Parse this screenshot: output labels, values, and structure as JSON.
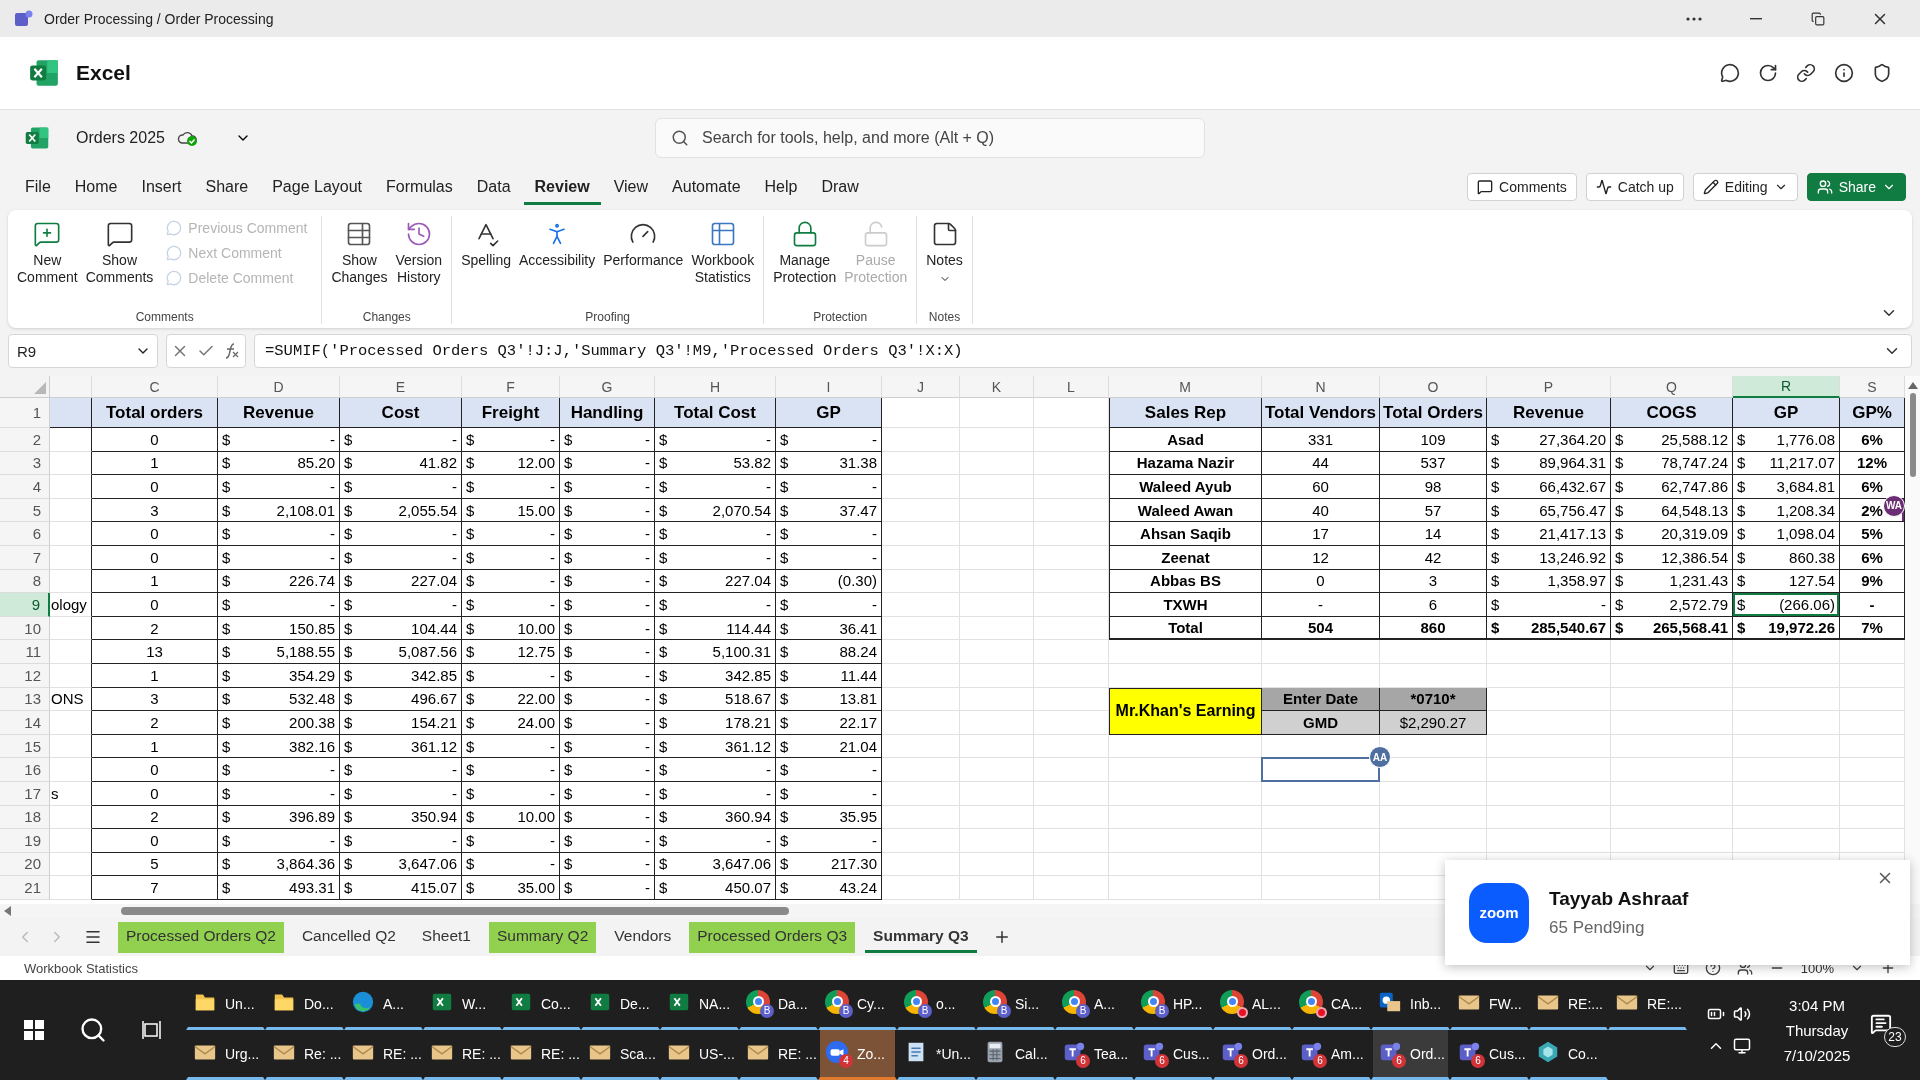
{
  "window": {
    "title": "Order Processing / Order Processing"
  },
  "app": {
    "name": "Excel"
  },
  "document": {
    "name": "Orders 2025"
  },
  "search": {
    "placeholder": "Search for tools, help, and more (Alt + Q)"
  },
  "menu_tabs": [
    {
      "label": "File",
      "selected": false
    },
    {
      "label": "Home",
      "selected": false
    },
    {
      "label": "Insert",
      "selected": false
    },
    {
      "label": "Share",
      "selected": false
    },
    {
      "label": "Page Layout",
      "selected": false
    },
    {
      "label": "Formulas",
      "selected": false
    },
    {
      "label": "Data",
      "selected": false
    },
    {
      "label": "Review",
      "selected": true
    },
    {
      "label": "View",
      "selected": false
    },
    {
      "label": "Automate",
      "selected": false
    },
    {
      "label": "Help",
      "selected": false
    },
    {
      "label": "Draw",
      "selected": false
    }
  ],
  "actions": [
    {
      "label": "Comments",
      "kind": "outline"
    },
    {
      "label": "Catch up",
      "kind": "outline"
    },
    {
      "label": "Editing",
      "kind": "dropdown"
    },
    {
      "label": "Share",
      "kind": "primary"
    }
  ],
  "ribbon": [
    {
      "name": "Comments",
      "items": [
        {
          "label": "New Comment",
          "kind": "large",
          "disabled": false
        },
        {
          "label": "Show Comments",
          "kind": "large",
          "disabled": false
        },
        {
          "label": "Previous Comment",
          "kind": "small",
          "disabled": true
        },
        {
          "label": "Next Comment",
          "kind": "small",
          "disabled": true
        },
        {
          "label": "Delete Comment",
          "kind": "small",
          "disabled": true
        }
      ]
    },
    {
      "name": "Changes",
      "items": [
        {
          "label": "Show Changes",
          "kind": "large",
          "disabled": false
        },
        {
          "label": "Version History",
          "kind": "large",
          "disabled": false
        }
      ]
    },
    {
      "name": "Proofing",
      "items": [
        {
          "label": "Spelling",
          "kind": "large",
          "disabled": false
        },
        {
          "label": "Accessibility",
          "kind": "large",
          "disabled": false
        },
        {
          "label": "Performance",
          "kind": "large",
          "disabled": false
        },
        {
          "label": "Workbook Statistics",
          "kind": "large",
          "disabled": false
        }
      ]
    },
    {
      "name": "Protection",
      "items": [
        {
          "label": "Manage Protection",
          "kind": "large",
          "disabled": false
        },
        {
          "label": "Pause Protection",
          "kind": "large",
          "disabled": true
        }
      ]
    },
    {
      "name": "Notes",
      "items": [
        {
          "label": "Notes",
          "kind": "menu",
          "disabled": false
        }
      ]
    }
  ],
  "formula_bar": {
    "name_box": "R9",
    "formula": "=SUMIF('Processed Orders Q3'!J:J,'Summary Q3'!M9,'Processed Orders Q3'!X:X)"
  },
  "sheet": {
    "column_headers": [
      {
        "label": "C",
        "selected": false
      },
      {
        "label": "D",
        "selected": false
      },
      {
        "label": "E",
        "selected": false
      },
      {
        "label": "F",
        "selected": false
      },
      {
        "label": "G",
        "selected": false
      },
      {
        "label": "H",
        "selected": false
      },
      {
        "label": "I",
        "selected": false
      },
      {
        "label": "J",
        "selected": false
      },
      {
        "label": "K",
        "selected": false
      },
      {
        "label": "L",
        "selected": false
      },
      {
        "label": "M",
        "selected": false
      },
      {
        "label": "N",
        "selected": false
      },
      {
        "label": "O",
        "selected": false
      },
      {
        "label": "P",
        "selected": false
      },
      {
        "label": "Q",
        "selected": false
      },
      {
        "label": "R",
        "selected": true
      },
      {
        "label": "S",
        "selected": false
      }
    ],
    "row_headers": [
      {
        "label": "1",
        "selected": false
      },
      {
        "label": "2",
        "selected": false
      },
      {
        "label": "3",
        "selected": false
      },
      {
        "label": "4",
        "selected": false
      },
      {
        "label": "5",
        "selected": false
      },
      {
        "label": "6",
        "selected": false
      },
      {
        "label": "7",
        "selected": false
      },
      {
        "label": "8",
        "selected": false
      },
      {
        "label": "9",
        "selected": true
      },
      {
        "label": "10",
        "selected": false
      },
      {
        "label": "11",
        "selected": false
      },
      {
        "label": "12",
        "selected": false
      },
      {
        "label": "13",
        "selected": false
      },
      {
        "label": "14",
        "selected": false
      },
      {
        "label": "15",
        "selected": false
      },
      {
        "label": "16",
        "selected": false
      },
      {
        "label": "17",
        "selected": false
      },
      {
        "label": "18",
        "selected": false
      },
      {
        "label": "19",
        "selected": false
      },
      {
        "label": "20",
        "selected": false
      },
      {
        "label": "21",
        "selected": false
      }
    ]
  },
  "orders_table": {
    "columns": [
      "Total orders",
      "Revenue",
      "Cost",
      "Freight",
      "Handling",
      "Total Cost",
      "GP"
    ],
    "rows": [
      {
        "values": [
          "0",
          [
            "$",
            "-"
          ],
          [
            "$",
            "-"
          ],
          [
            "$",
            "-"
          ],
          [
            "$",
            "-"
          ],
          [
            "$",
            "-"
          ],
          [
            "$",
            "-"
          ]
        ]
      },
      {
        "values": [
          "1",
          [
            "$",
            "85.20"
          ],
          [
            "$",
            "41.82"
          ],
          [
            "$",
            "12.00"
          ],
          [
            "$",
            "-"
          ],
          [
            "$",
            "53.82"
          ],
          [
            "$",
            "31.38"
          ]
        ]
      },
      {
        "values": [
          "0",
          [
            "$",
            "-"
          ],
          [
            "$",
            "-"
          ],
          [
            "$",
            "-"
          ],
          [
            "$",
            "-"
          ],
          [
            "$",
            "-"
          ],
          [
            "$",
            "-"
          ]
        ]
      },
      {
        "values": [
          "3",
          [
            "$",
            "2,108.01"
          ],
          [
            "$",
            "2,055.54"
          ],
          [
            "$",
            "15.00"
          ],
          [
            "$",
            "-"
          ],
          [
            "$",
            "2,070.54"
          ],
          [
            "$",
            "37.47"
          ]
        ]
      },
      {
        "values": [
          "0",
          [
            "$",
            "-"
          ],
          [
            "$",
            "-"
          ],
          [
            "$",
            "-"
          ],
          [
            "$",
            "-"
          ],
          [
            "$",
            "-"
          ],
          [
            "$",
            "-"
          ]
        ]
      },
      {
        "values": [
          "0",
          [
            "$",
            "-"
          ],
          [
            "$",
            "-"
          ],
          [
            "$",
            "-"
          ],
          [
            "$",
            "-"
          ],
          [
            "$",
            "-"
          ],
          [
            "$",
            "-"
          ]
        ]
      },
      {
        "values": [
          "1",
          [
            "$",
            "226.74"
          ],
          [
            "$",
            "227.04"
          ],
          [
            "$",
            "-"
          ],
          [
            "$",
            "-"
          ],
          [
            "$",
            "227.04"
          ],
          [
            "$",
            "(0.30)"
          ]
        ]
      },
      {
        "column_1": "ology",
        "values": [
          "0",
          [
            "$",
            "-"
          ],
          [
            "$",
            "-"
          ],
          [
            "$",
            "-"
          ],
          [
            "$",
            "-"
          ],
          [
            "$",
            "-"
          ],
          [
            "$",
            "-"
          ]
        ]
      },
      {
        "values": [
          "2",
          [
            "$",
            "150.85"
          ],
          [
            "$",
            "104.44"
          ],
          [
            "$",
            "10.00"
          ],
          [
            "$",
            "-"
          ],
          [
            "$",
            "114.44"
          ],
          [
            "$",
            "36.41"
          ]
        ]
      },
      {
        "values": [
          "13",
          [
            "$",
            "5,188.55"
          ],
          [
            "$",
            "5,087.56"
          ],
          [
            "$",
            "12.75"
          ],
          [
            "$",
            "-"
          ],
          [
            "$",
            "5,100.31"
          ],
          [
            "$",
            "88.24"
          ]
        ]
      },
      {
        "values": [
          "1",
          [
            "$",
            "354.29"
          ],
          [
            "$",
            "342.85"
          ],
          [
            "$",
            "-"
          ],
          [
            "$",
            "-"
          ],
          [
            "$",
            "342.85"
          ],
          [
            "$",
            "11.44"
          ]
        ]
      },
      {
        "column_1": "ONS",
        "values": [
          "3",
          [
            "$",
            "532.48"
          ],
          [
            "$",
            "496.67"
          ],
          [
            "$",
            "22.00"
          ],
          [
            "$",
            "-"
          ],
          [
            "$",
            "518.67"
          ],
          [
            "$",
            "13.81"
          ]
        ]
      },
      {
        "values": [
          "2",
          [
            "$",
            "200.38"
          ],
          [
            "$",
            "154.21"
          ],
          [
            "$",
            "24.00"
          ],
          [
            "$",
            "-"
          ],
          [
            "$",
            "178.21"
          ],
          [
            "$",
            "22.17"
          ]
        ]
      },
      {
        "values": [
          "1",
          [
            "$",
            "382.16"
          ],
          [
            "$",
            "361.12"
          ],
          [
            "$",
            "-"
          ],
          [
            "$",
            "-"
          ],
          [
            "$",
            "361.12"
          ],
          [
            "$",
            "21.04"
          ]
        ]
      },
      {
        "values": [
          "0",
          [
            "$",
            "-"
          ],
          [
            "$",
            "-"
          ],
          [
            "$",
            "-"
          ],
          [
            "$",
            "-"
          ],
          [
            "$",
            "-"
          ],
          [
            "$",
            "-"
          ]
        ]
      },
      {
        "column_1": "s",
        "values": [
          "0",
          [
            "$",
            "-"
          ],
          [
            "$",
            "-"
          ],
          [
            "$",
            "-"
          ],
          [
            "$",
            "-"
          ],
          [
            "$",
            "-"
          ],
          [
            "$",
            "-"
          ]
        ]
      },
      {
        "values": [
          "2",
          [
            "$",
            "396.89"
          ],
          [
            "$",
            "350.94"
          ],
          [
            "$",
            "10.00"
          ],
          [
            "$",
            "-"
          ],
          [
            "$",
            "360.94"
          ],
          [
            "$",
            "35.95"
          ]
        ]
      },
      {
        "values": [
          "0",
          [
            "$",
            "-"
          ],
          [
            "$",
            "-"
          ],
          [
            "$",
            "-"
          ],
          [
            "$",
            "-"
          ],
          [
            "$",
            "-"
          ],
          [
            "$",
            "-"
          ]
        ]
      },
      {
        "values": [
          "5",
          [
            "$",
            "3,864.36"
          ],
          [
            "$",
            "3,647.06"
          ],
          [
            "$",
            "-"
          ],
          [
            "$",
            "-"
          ],
          [
            "$",
            "3,647.06"
          ],
          [
            "$",
            "217.30"
          ]
        ]
      },
      {
        "values": [
          "7",
          [
            "$",
            "493.31"
          ],
          [
            "$",
            "415.07"
          ],
          [
            "$",
            "35.00"
          ],
          [
            "$",
            "-"
          ],
          [
            "$",
            "450.07"
          ],
          [
            "$",
            "43.24"
          ]
        ]
      }
    ]
  },
  "sales_table": {
    "columns": [
      "Sales Rep",
      "Total Vendors",
      "Total Orders",
      "Revenue",
      "COGS",
      "GP",
      "GP%"
    ],
    "rows": [
      {
        "kind": "rep",
        "values": [
          "Asad",
          "331",
          "109",
          [
            "$",
            "27,364.20"
          ],
          [
            "$",
            "25,588.12"
          ],
          [
            "$",
            "1,776.08"
          ],
          "6%"
        ]
      },
      {
        "kind": "rep",
        "values": [
          "Hazama Nazir",
          "44",
          "537",
          [
            "$",
            "89,964.31"
          ],
          [
            "$",
            "78,747.24"
          ],
          [
            "$",
            "11,217.07"
          ],
          "12%"
        ]
      },
      {
        "kind": "rep",
        "values": [
          "Waleed Ayub",
          "60",
          "98",
          [
            "$",
            "66,432.67"
          ],
          [
            "$",
            "62,747.86"
          ],
          [
            "$",
            "3,684.81"
          ],
          "6%"
        ]
      },
      {
        "kind": "rep",
        "values": [
          "Waleed Awan",
          "40",
          "57",
          [
            "$",
            "65,756.47"
          ],
          [
            "$",
            "64,548.13"
          ],
          [
            "$",
            "1,208.34"
          ],
          "2%"
        ]
      },
      {
        "kind": "rep",
        "values": [
          "Ahsan Saqib",
          "17",
          "14",
          [
            "$",
            "21,417.13"
          ],
          [
            "$",
            "20,319.09"
          ],
          [
            "$",
            "1,098.04"
          ],
          "5%"
        ]
      },
      {
        "kind": "rep",
        "values": [
          "Zeenat",
          "12",
          "42",
          [
            "$",
            "13,246.92"
          ],
          [
            "$",
            "12,386.54"
          ],
          [
            "$",
            "860.38"
          ],
          "6%"
        ]
      },
      {
        "kind": "rep",
        "values": [
          "Abbas BS",
          "0",
          "3",
          [
            "$",
            "1,358.97"
          ],
          [
            "$",
            "1,231.43"
          ],
          [
            "$",
            "127.54"
          ],
          "9%"
        ]
      },
      {
        "kind": "rep",
        "values": [
          "TXWH",
          "-",
          "6",
          [
            "$",
            "-"
          ],
          [
            "$",
            "2,572.79"
          ],
          [
            "$",
            "(266.06)"
          ],
          "-"
        ]
      },
      {
        "kind": "total",
        "values": [
          "Total",
          "504",
          "860",
          [
            "$",
            "285,540.67"
          ],
          [
            "$",
            "265,568.41"
          ],
          [
            "$",
            "19,972.26"
          ],
          "7%"
        ]
      }
    ]
  },
  "earning": {
    "label": "Mr.Khan's Earning",
    "fields": [
      {
        "label": "Enter Date",
        "value": "*0710*"
      },
      {
        "label": "GMD",
        "value": "$2,290.27"
      }
    ]
  },
  "collaborators": [
    {
      "initials": "WA",
      "color": "#6b2d73"
    },
    {
      "initials": "AA",
      "color": "#4f6fa0"
    }
  ],
  "sheet_tabs": [
    {
      "label": "Processed Orders Q2",
      "color": "#92d050",
      "selected": false
    },
    {
      "label": "Cancelled Q2",
      "selected": false
    },
    {
      "label": "Sheet1",
      "selected": false
    },
    {
      "label": "Summary Q2",
      "color": "#92d050",
      "selected": false
    },
    {
      "label": "Vendors",
      "selected": false
    },
    {
      "label": "Processed Orders Q3",
      "color": "#92d050",
      "selected": false
    },
    {
      "label": "Summary Q3",
      "selected": true
    }
  ],
  "status_bar": {
    "text": "Workbook Statistics",
    "zoom": "100%"
  },
  "notification": {
    "logo": "zoom",
    "title": "Tayyab Ashraaf",
    "message": "65 Pend9ing"
  },
  "taskbar": {
    "rows": [
      [
        {
          "kind": "folder",
          "label": "Un...",
          "selected": false,
          "flashing": false,
          "alert": false
        },
        {
          "kind": "folder",
          "label": "Do...",
          "selected": false,
          "flashing": false,
          "alert": false
        },
        {
          "kind": "edge",
          "label": "A...",
          "selected": false,
          "flashing": false,
          "alert": false
        },
        {
          "kind": "excel",
          "label": "W...",
          "selected": false,
          "flashing": false,
          "alert": false
        },
        {
          "kind": "excel",
          "label": "Co...",
          "selected": false,
          "flashing": false,
          "alert": false
        },
        {
          "kind": "excel",
          "label": "De...",
          "selected": false,
          "flashing": false,
          "alert": false
        },
        {
          "kind": "excel",
          "label": "NA...",
          "selected": false,
          "flashing": false,
          "alert": false
        },
        {
          "kind": "chrome",
          "label": "Da...",
          "badge": "B",
          "selected": false,
          "flashing": false,
          "alert": false
        },
        {
          "kind": "chrome",
          "label": "Cy...",
          "badge": "B",
          "selected": false,
          "flashing": false,
          "alert": false
        },
        {
          "kind": "chrome",
          "label": "o...",
          "badge": "B",
          "selected": false,
          "flashing": false,
          "alert": false
        },
        {
          "kind": "chrome",
          "label": "Si...",
          "badge": "B",
          "selected": false,
          "flashing": false,
          "alert": false
        },
        {
          "kind": "chrome",
          "label": "A...",
          "badge": "B",
          "selected": false,
          "flashing": false,
          "alert": false
        },
        {
          "kind": "chrome",
          "label": "HP...",
          "badge": "B",
          "selected": false,
          "flashing": false,
          "alert": false
        },
        {
          "kind": "chrome",
          "label": "AL...",
          "selected": false,
          "flashing": false,
          "alert": true
        },
        {
          "kind": "chrome",
          "label": "CA...",
          "selected": false,
          "flashing": false,
          "alert": true
        },
        {
          "kind": "outlook",
          "label": "Inb...",
          "selected": false,
          "flashing": false,
          "alert": false
        },
        {
          "kind": "mail",
          "label": "FW...",
          "selected": false,
          "flashing": false,
          "alert": false
        },
        {
          "kind": "mail",
          "label": "RE:...",
          "selected": false,
          "flashing": false,
          "alert": false
        },
        {
          "kind": "mail",
          "label": "RE:...",
          "selected": false,
          "flashing": false,
          "alert": false
        }
      ],
      [
        {
          "kind": "mail",
          "label": "Urg...",
          "selected": false,
          "flashing": false,
          "alert": false
        },
        {
          "kind": "mail",
          "label": "Re: ...",
          "selected": false,
          "flashing": false,
          "alert": false
        },
        {
          "kind": "mail",
          "label": "RE: ...",
          "selected": false,
          "flashing": false,
          "alert": false
        },
        {
          "kind": "mail",
          "label": "RE: ...",
          "selected": false,
          "flashing": false,
          "alert": false
        },
        {
          "kind": "mail",
          "label": "RE: ...",
          "selected": false,
          "flashing": false,
          "alert": false
        },
        {
          "kind": "mail",
          "label": "Sca...",
          "selected": false,
          "flashing": false,
          "alert": false
        },
        {
          "kind": "mail",
          "label": "US-...",
          "selected": false,
          "flashing": false,
          "alert": false
        },
        {
          "kind": "mail",
          "label": "RE: ...",
          "selected": false,
          "flashing": false,
          "alert": false
        },
        {
          "kind": "zoom",
          "label": "Zo...",
          "badge": "4",
          "selected": false,
          "flashing": true,
          "alert": false
        },
        {
          "kind": "notepad",
          "label": "*Un...",
          "selected": false,
          "flashing": false,
          "alert": false
        },
        {
          "kind": "calculator",
          "label": "Cal...",
          "selected": false,
          "flashing": false,
          "alert": false
        },
        {
          "kind": "teams",
          "label": "Tea...",
          "badge": "6",
          "selected": false,
          "flashing": false,
          "alert": false
        },
        {
          "kind": "teams",
          "label": "Cus...",
          "badge": "6",
          "selected": false,
          "flashing": false,
          "alert": false
        },
        {
          "kind": "teams",
          "label": "Ord...",
          "badge": "6",
          "selected": false,
          "flashing": false,
          "alert": false
        },
        {
          "kind": "teams",
          "label": "Am...",
          "badge": "6",
          "selected": false,
          "flashing": false,
          "alert": false
        },
        {
          "kind": "teams",
          "label": "Ord...",
          "badge": "6",
          "selected": true,
          "flashing": false,
          "alert": false
        },
        {
          "kind": "teams",
          "label": "Cus...",
          "badge": "6",
          "selected": false,
          "flashing": false,
          "alert": false
        },
        {
          "kind": "other",
          "label": "Co...",
          "selected": false,
          "flashing": false,
          "alert": false
        }
      ]
    ],
    "clock": {
      "time": "3:04 PM",
      "day": "Thursday",
      "date": "7/10/2025"
    },
    "notification_count": "23"
  }
}
